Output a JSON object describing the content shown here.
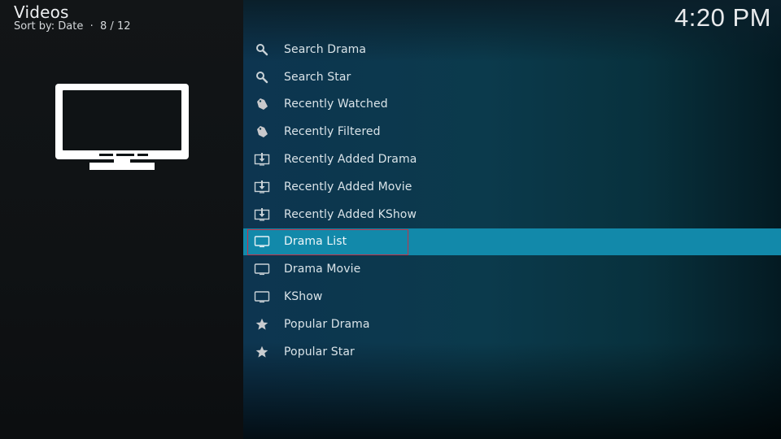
{
  "header": {
    "title": "Videos",
    "sort_label": "Sort by: Date",
    "separator": "·",
    "position": "8 / 12",
    "subtitle": "Sort by: Date  ·  8 / 12"
  },
  "clock": {
    "time": "4:20 PM"
  },
  "artwork": {
    "icon": "tv-icon"
  },
  "menu": {
    "selected_index": 7,
    "items": [
      {
        "label": "Search Drama",
        "icon": "search-icon"
      },
      {
        "label": "Search Star",
        "icon": "search-icon"
      },
      {
        "label": "Recently Watched",
        "icon": "tag-icon"
      },
      {
        "label": "Recently Filtered",
        "icon": "tag-icon"
      },
      {
        "label": "Recently Added Drama",
        "icon": "download-tv-icon"
      },
      {
        "label": "Recently Added Movie",
        "icon": "download-tv-icon"
      },
      {
        "label": "Recently Added KShow",
        "icon": "download-tv-icon"
      },
      {
        "label": "Drama List",
        "icon": "tv-icon"
      },
      {
        "label": "Drama Movie",
        "icon": "tv-icon"
      },
      {
        "label": "KShow",
        "icon": "tv-icon"
      },
      {
        "label": "Popular Drama",
        "icon": "star-icon"
      },
      {
        "label": "Popular Star",
        "icon": "star-icon"
      }
    ]
  },
  "colors": {
    "focus_bar": "#1289aa",
    "focus_outline": "#c0344a",
    "left_panel": "#111416",
    "right_panel": "#0b3a4c"
  }
}
